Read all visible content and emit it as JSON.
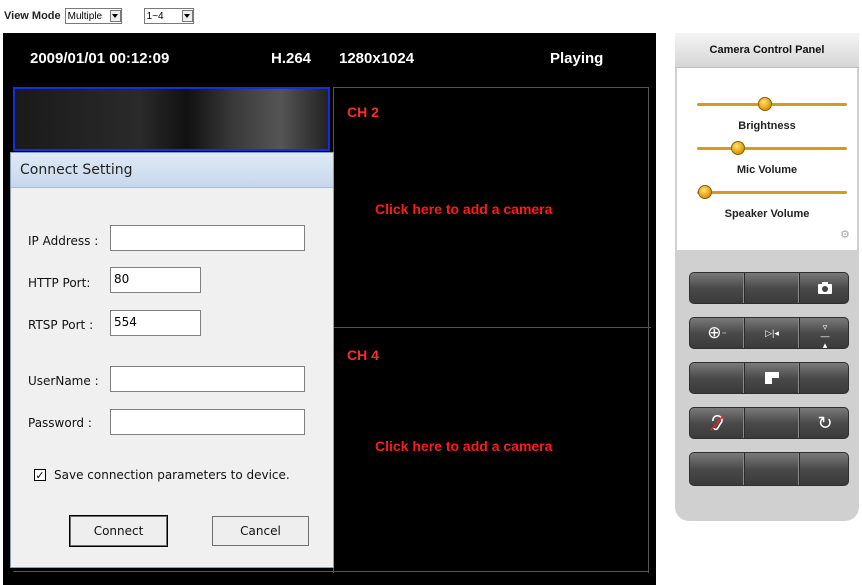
{
  "view_bar": {
    "label": "View Mode",
    "mode_value": "Multiple",
    "range_value": "1~4"
  },
  "status": {
    "datetime": "2009/01/01 00:12:09",
    "codec": "H.264",
    "resolution": "1280x1024",
    "state": "Playing"
  },
  "channels": [
    {
      "label": "CH 2",
      "add_text": "Click here to add a camera"
    },
    {
      "label": "CH 4",
      "add_text": "Click here to add a camera"
    }
  ],
  "dialog": {
    "title": "Connect Setting",
    "ip_label": "IP Address :",
    "ip_value": "",
    "http_label": "HTTP Port:",
    "http_value": "80",
    "rtsp_label": "RTSP Port :",
    "rtsp_value": "554",
    "user_label": "UserName :",
    "user_value": "",
    "pass_label": "Password :",
    "pass_value": "",
    "save_label": "Save connection parameters  to device.",
    "save_checked": true,
    "connect_label": "Connect",
    "cancel_label": "Cancel"
  },
  "panel": {
    "title": "Camera Control Panel",
    "sliders": [
      {
        "label": "Brightness",
        "level": 0.45
      },
      {
        "label": "Mic Volume",
        "level": 0.27
      },
      {
        "label": "Speaker Volume",
        "level": 0.05
      }
    ],
    "button_icons": [
      [
        "",
        "",
        "camera-icon"
      ],
      [
        "zoom-icon",
        "flip-horizontal-icon",
        "flip-vertical-icon"
      ],
      [
        "",
        "mirror-icon",
        ""
      ],
      [
        "ear-icon",
        "",
        "rotate-icon"
      ],
      [
        "",
        "",
        ""
      ]
    ]
  },
  "colors": {
    "alert_red": "#ff1a1a",
    "select_border": "#1030e0",
    "slider_gold": "#e5a10a"
  }
}
